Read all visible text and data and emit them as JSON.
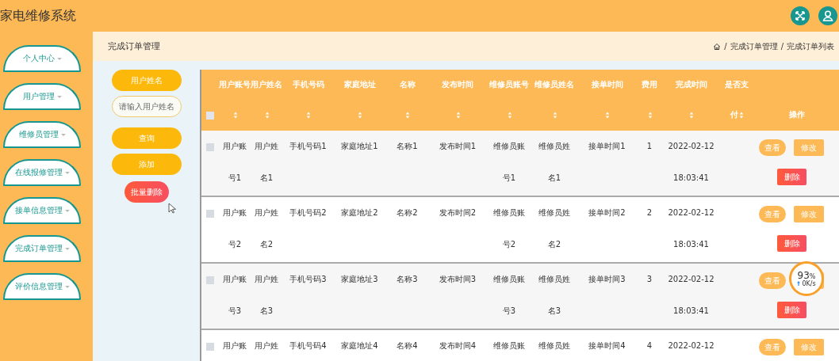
{
  "app_title": "家电维修系统",
  "sidebar": {
    "items": [
      {
        "label": "个人中心"
      },
      {
        "label": "用户管理"
      },
      {
        "label": "维修员管理"
      },
      {
        "label": "在线报修管理"
      },
      {
        "label": "接单信息管理"
      },
      {
        "label": "完成订单管理"
      },
      {
        "label": "评价信息管理"
      }
    ]
  },
  "page_title": "完成订单管理",
  "breadcrumb": {
    "separator": "/",
    "items": [
      "完成订单管理",
      "完成订单列表"
    ]
  },
  "search": {
    "label": "用户姓名",
    "placeholder": "请输入用户姓名",
    "buttons": [
      {
        "kind": "primary",
        "label": "查询"
      },
      {
        "kind": "primary",
        "label": "添加"
      },
      {
        "kind": "danger",
        "label": "批量删除"
      }
    ]
  },
  "table": {
    "header_checked": false,
    "columns": [
      {
        "lines": [
          "用户账号"
        ],
        "sortable": true
      },
      {
        "lines": [
          "用户姓名"
        ],
        "sortable": true
      },
      {
        "lines": [
          "手机号码"
        ],
        "sortable": true
      },
      {
        "lines": [
          "家庭地址"
        ],
        "sortable": true
      },
      {
        "lines": [
          "名称"
        ],
        "sortable": true
      },
      {
        "lines": [
          "发布时间"
        ],
        "sortable": true
      },
      {
        "lines": [
          "维修员账号"
        ],
        "sortable": true
      },
      {
        "lines": [
          "维修员姓名"
        ],
        "sortable": true
      },
      {
        "lines": [
          "接单时间"
        ],
        "sortable": true
      },
      {
        "lines": [
          "费用"
        ],
        "sortable": true
      },
      {
        "lines": [
          "完成时间"
        ],
        "sortable": true
      },
      {
        "lines": [
          "是否支",
          "付"
        ],
        "sortable": true
      },
      {
        "lines": [
          "操作"
        ],
        "sortable": false
      }
    ],
    "rows": [
      {
        "checked": false,
        "cells": [
          [
            "用户账",
            "号1"
          ],
          [
            "用户姓",
            "名1"
          ],
          [
            "手机号码1"
          ],
          [
            "家庭地址1"
          ],
          [
            "名称1"
          ],
          [
            "发布时间1"
          ],
          [
            "维修员账",
            "号1"
          ],
          [
            "维修员姓",
            "名1"
          ],
          [
            "接单时间1"
          ],
          [
            "1"
          ],
          [
            "2022-02-12",
            "18:03:41"
          ],
          []
        ],
        "actions": [
          {
            "kind": "view",
            "label": "查看"
          },
          {
            "kind": "edit",
            "label": "修改"
          },
          {
            "kind": "delete",
            "label": "删除"
          }
        ]
      },
      {
        "checked": false,
        "cells": [
          [
            "用户账",
            "号2"
          ],
          [
            "用户姓",
            "名2"
          ],
          [
            "手机号码2"
          ],
          [
            "家庭地址2"
          ],
          [
            "名称2"
          ],
          [
            "发布时间2"
          ],
          [
            "维修员账",
            "号2"
          ],
          [
            "维修员姓",
            "名2"
          ],
          [
            "接单时间2"
          ],
          [
            "2"
          ],
          [
            "2022-02-12",
            "18:03:41"
          ],
          []
        ],
        "actions": [
          {
            "kind": "view",
            "label": "查看"
          },
          {
            "kind": "edit",
            "label": "修改"
          },
          {
            "kind": "delete",
            "label": "删除"
          }
        ]
      },
      {
        "checked": false,
        "cells": [
          [
            "用户账",
            "号3"
          ],
          [
            "用户姓",
            "名3"
          ],
          [
            "手机号码3"
          ],
          [
            "家庭地址3"
          ],
          [
            "名称3"
          ],
          [
            "发布时间3"
          ],
          [
            "维修员账",
            "号3"
          ],
          [
            "维修员姓",
            "名3"
          ],
          [
            "接单时间3"
          ],
          [
            "3"
          ],
          [
            "2022-02-12",
            "18:03:41"
          ],
          []
        ],
        "actions": [
          {
            "kind": "view",
            "label": "查看"
          },
          {
            "kind": "edit"
          },
          {
            "kind": "delete",
            "label": "删除"
          }
        ]
      },
      {
        "checked": false,
        "cells": [
          [
            "用户账"
          ],
          [
            "用户姓"
          ],
          [
            "手机号码4"
          ],
          [
            "家庭地址4"
          ],
          [
            "名称4"
          ],
          [
            "发布时间4"
          ],
          [
            "维修员账"
          ],
          [
            "维修员姓"
          ],
          [
            "接单时间4"
          ],
          [
            "4"
          ],
          [
            "2022-02-12"
          ],
          []
        ],
        "actions": [
          {
            "kind": "view",
            "label": "查看"
          },
          {
            "kind": "edit",
            "label": "修改"
          }
        ]
      }
    ]
  },
  "speed_widget": {
    "percent": "93",
    "unit": "%",
    "speed": "0K/s"
  }
}
